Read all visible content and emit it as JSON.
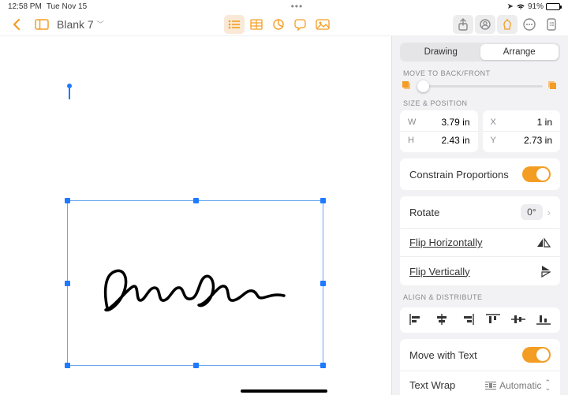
{
  "status": {
    "time": "12:58 PM",
    "date": "Tue Nov 15",
    "dots": "•••",
    "battery_pct": "91%"
  },
  "doc": {
    "title": "Blank 7"
  },
  "panel": {
    "tabs": {
      "drawing": "Drawing",
      "arrange": "Arrange"
    },
    "move_label": "MOVE TO BACK/FRONT",
    "size_label": "SIZE & POSITION",
    "dims": {
      "w_k": "W",
      "w_v": "3.79 in",
      "h_k": "H",
      "h_v": "2.43 in",
      "x_k": "X",
      "x_v": "1 in",
      "y_k": "Y",
      "y_v": "2.73 in"
    },
    "constrain": "Constrain Proportions",
    "rotate": "Rotate",
    "rotate_val": "0°",
    "fliph": "Flip Horizontally",
    "flipv": "Flip Vertically",
    "align_label": "ALIGN & DISTRIBUTE",
    "movewith": "Move with Text",
    "wrap": "Text Wrap",
    "wrap_val": "Automatic"
  }
}
